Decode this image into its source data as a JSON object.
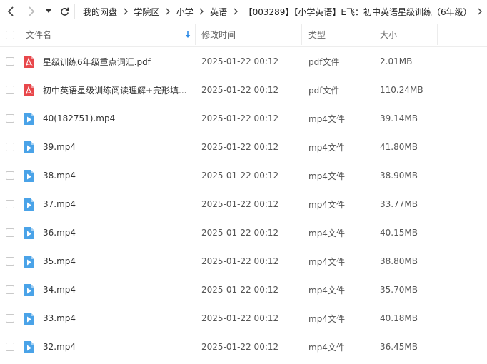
{
  "toolbar": {
    "back_icon": "chevron-left-icon",
    "forward_icon": "chevron-right-icon",
    "dropdown_icon": "caret-down-icon",
    "refresh_icon": "refresh-icon",
    "breadcrumbs": [
      "我的网盘",
      "学院区",
      "小学",
      "英语",
      "【003289】【小学英语】E飞：初中英语星级训练（6年级）"
    ]
  },
  "header": {
    "name_label": "文件名",
    "sort_icon": "sort-down-arrow-icon",
    "date_label": "修改时间",
    "type_label": "类型",
    "size_label": "大小"
  },
  "colors": {
    "pdf": "#e8474b",
    "video": "#4aa3e8",
    "sort_arrow": "#2e8be6"
  },
  "files": [
    {
      "icon": "pdf-icon",
      "name": "星级训练6年级重点词汇.pdf",
      "modified": "2025-01-22 00:12",
      "type": "pdf文件",
      "size": "2.01MB"
    },
    {
      "icon": "pdf-icon",
      "name": "初中英语星级训练阅读理解+完形填...",
      "modified": "2025-01-22 00:12",
      "type": "pdf文件",
      "size": "110.24MB"
    },
    {
      "icon": "video-icon",
      "name": "40(182751).mp4",
      "modified": "2025-01-22 00:12",
      "type": "mp4文件",
      "size": "39.14MB"
    },
    {
      "icon": "video-icon",
      "name": "39.mp4",
      "modified": "2025-01-22 00:12",
      "type": "mp4文件",
      "size": "41.80MB"
    },
    {
      "icon": "video-icon",
      "name": "38.mp4",
      "modified": "2025-01-22 00:12",
      "type": "mp4文件",
      "size": "38.90MB"
    },
    {
      "icon": "video-icon",
      "name": "37.mp4",
      "modified": "2025-01-22 00:12",
      "type": "mp4文件",
      "size": "33.77MB"
    },
    {
      "icon": "video-icon",
      "name": "36.mp4",
      "modified": "2025-01-22 00:12",
      "type": "mp4文件",
      "size": "40.15MB"
    },
    {
      "icon": "video-icon",
      "name": "35.mp4",
      "modified": "2025-01-22 00:12",
      "type": "mp4文件",
      "size": "38.80MB"
    },
    {
      "icon": "video-icon",
      "name": "34.mp4",
      "modified": "2025-01-22 00:12",
      "type": "mp4文件",
      "size": "35.70MB"
    },
    {
      "icon": "video-icon",
      "name": "33.mp4",
      "modified": "2025-01-22 00:12",
      "type": "mp4文件",
      "size": "40.18MB"
    },
    {
      "icon": "video-icon",
      "name": "32.mp4",
      "modified": "2025-01-22 00:12",
      "type": "mp4文件",
      "size": "36.45MB"
    }
  ]
}
